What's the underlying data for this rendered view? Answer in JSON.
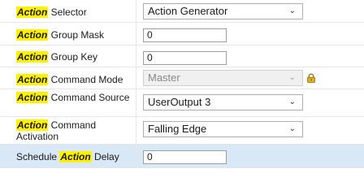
{
  "highlight_word": "Action",
  "rows": [
    {
      "prefix": "",
      "suffix": " Selector",
      "value": "Action Generator",
      "control": "combo"
    },
    {
      "prefix": "",
      "suffix": " Group Mask",
      "value": "0",
      "control": "text"
    },
    {
      "prefix": "",
      "suffix": " Group Key",
      "value": "0",
      "control": "text"
    },
    {
      "prefix": "",
      "suffix": " Command Mode",
      "value": "Master",
      "control": "combo-disabled"
    },
    {
      "prefix": "",
      "suffix": " Command Source",
      "value": "UserOutput 3",
      "control": "combo"
    },
    {
      "prefix": "",
      "suffix": " Command Activation",
      "value": "Falling Edge",
      "control": "combo"
    },
    {
      "prefix": "Schedule ",
      "suffix": " Delay",
      "value": "0",
      "control": "text"
    }
  ],
  "icons": {
    "lock": "lock-icon",
    "dropdown": "chevron-down-icon"
  }
}
